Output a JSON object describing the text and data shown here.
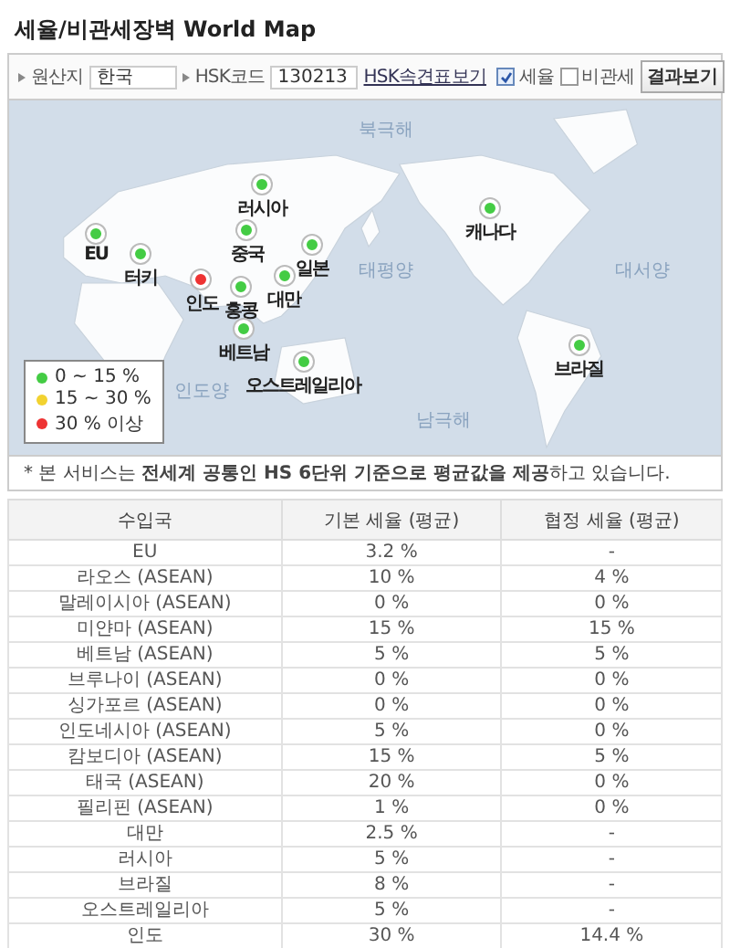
{
  "title": "세율/비관세장벽 World Map",
  "filters": {
    "origin_label": "원산지",
    "origin_value": "한국",
    "hsk_label": "HSK코드",
    "hsk_value": "130213",
    "link": "HSK속견표보기",
    "options": [
      {
        "label": "세율",
        "checked": true
      },
      {
        "label": "비관세",
        "checked": false
      }
    ],
    "button": "결과보기"
  },
  "map": {
    "oceans": [
      "북극해",
      "태평양",
      "대서양",
      "인도양",
      "남극해"
    ],
    "markers": [
      {
        "label": "러시아",
        "color": "#44cc44"
      },
      {
        "label": "EU",
        "color": "#44cc44"
      },
      {
        "label": "터키",
        "color": "#44cc44"
      },
      {
        "label": "중국",
        "color": "#44cc44"
      },
      {
        "label": "일본",
        "color": "#44cc44"
      },
      {
        "label": "인도",
        "color": "#ee3333"
      },
      {
        "label": "홍콩",
        "color": "#44cc44"
      },
      {
        "label": "대만",
        "color": "#44cc44"
      },
      {
        "label": "캐나다",
        "color": "#44cc44"
      },
      {
        "label": "베트남",
        "color": "#44cc44"
      },
      {
        "label": "오스트레일리아",
        "color": "#44cc44"
      },
      {
        "label": "브라질",
        "color": "#44cc44"
      }
    ],
    "legend": [
      {
        "label": "0 ~ 15 %",
        "color": "#44cc44"
      },
      {
        "label": "15 ~ 30 %",
        "color": "#f2d230"
      },
      {
        "label": "30 % 이상",
        "color": "#ee3333"
      }
    ]
  },
  "notice": "* 본 서비스는 **전세계 공통인 HS 6단위 기준으로 평균값을 제공**하고 있습니다.",
  "table": {
    "columns": [
      "수입국",
      "기본 세율 (평균)",
      "협정 세율 (평균)"
    ],
    "rows": [
      [
        "EU",
        "3.2 %",
        "-"
      ],
      [
        "라오스 (ASEAN)",
        "10 %",
        "4 %"
      ],
      [
        "말레이시아 (ASEAN)",
        "0 %",
        "0 %"
      ],
      [
        "미얀마 (ASEAN)",
        "15 %",
        "15 %"
      ],
      [
        "베트남 (ASEAN)",
        "5 %",
        "5 %"
      ],
      [
        "브루나이 (ASEAN)",
        "0 %",
        "0 %"
      ],
      [
        "싱가포르 (ASEAN)",
        "0 %",
        "0 %"
      ],
      [
        "인도네시아 (ASEAN)",
        "5 %",
        "0 %"
      ],
      [
        "캄보디아 (ASEAN)",
        "15 %",
        "5 %"
      ],
      [
        "태국 (ASEAN)",
        "20 %",
        "0 %"
      ],
      [
        "필리핀 (ASEAN)",
        "1 %",
        "0 %"
      ],
      [
        "대만",
        "2.5 %",
        "-"
      ],
      [
        "러시아",
        "5 %",
        "-"
      ],
      [
        "브라질",
        "8 %",
        "-"
      ],
      [
        "오스트레일리아",
        "5 %",
        "-"
      ],
      [
        "인도",
        "30 %",
        "14.4 %"
      ]
    ]
  }
}
